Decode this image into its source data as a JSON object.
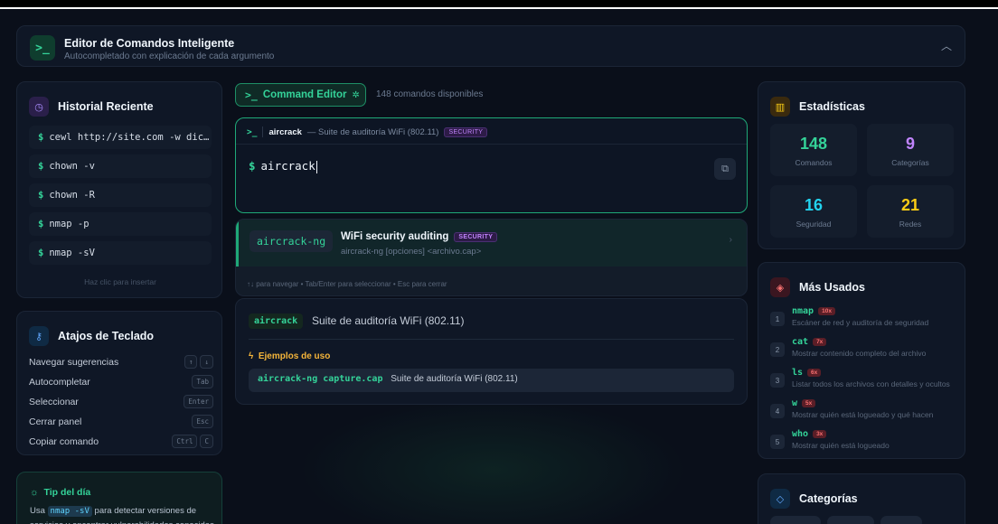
{
  "header": {
    "title": "Editor de Comandos Inteligente",
    "subtitle": "Autocompletado con explicación de cada argumento"
  },
  "history": {
    "title": "Historial Reciente",
    "items": [
      "cewl http://site.com -w dic…",
      "chown -v",
      "chown -R",
      "nmap -p",
      "nmap -sV"
    ],
    "hint": "Haz clic para insertar"
  },
  "shortcuts": {
    "title": "Atajos de Teclado",
    "rows": [
      {
        "label": "Navegar sugerencias",
        "keys": [
          "↑",
          "↓"
        ]
      },
      {
        "label": "Autocompletar",
        "keys": [
          "Tab"
        ]
      },
      {
        "label": "Seleccionar",
        "keys": [
          "Enter"
        ]
      },
      {
        "label": "Cerrar panel",
        "keys": [
          "Esc"
        ]
      },
      {
        "label": "Copiar comando",
        "keys": [
          "Ctrl",
          "C"
        ]
      }
    ]
  },
  "tip": {
    "title": "Tip del día",
    "text_before": "Usa",
    "code": "nmap -sV",
    "text_after": "para detectar versiones de servicios y encontrar vulnerabilidades conocidas"
  },
  "editor": {
    "button_label": "Command Editor",
    "count_text": "148 comandos disponibles",
    "current_cmd": "aircrack",
    "current_desc": "— Suite de auditoría WiFi (802.11)",
    "badge": "SECURITY",
    "input_value": "aircrack"
  },
  "suggestion": {
    "tag": "aircrack-ng",
    "title": "WiFi security auditing",
    "badge": "SECURITY",
    "usage": "aircrack-ng [opciones] <archivo.cap>",
    "hint": "↑↓ para navegar • Tab/Enter para seleccionar • Esc para cerrar"
  },
  "details": {
    "tag": "aircrack",
    "desc": "Suite de auditoría WiFi (802.11)",
    "examples_title": "Ejemplos de uso",
    "example_cmd": "aircrack-ng capture.cap",
    "example_desc": "Suite de auditoría WiFi (802.11)"
  },
  "stats": {
    "title": "Estadísticas",
    "cards": [
      {
        "num": "148",
        "label": "Comandos",
        "color": "#34d399"
      },
      {
        "num": "9",
        "label": "Categorías",
        "color": "#c084fc"
      },
      {
        "num": "16",
        "label": "Seguridad",
        "color": "#22d3ee"
      },
      {
        "num": "21",
        "label": "Redes",
        "color": "#facc15"
      }
    ]
  },
  "most_used": {
    "title": "Más Usados",
    "items": [
      {
        "rank": "1",
        "cmd": "nmap",
        "count": "10x",
        "desc": "Escáner de red y auditoría de seguridad"
      },
      {
        "rank": "2",
        "cmd": "cat",
        "count": "7x",
        "desc": "Mostrar contenido completo del archivo"
      },
      {
        "rank": "3",
        "cmd": "ls",
        "count": "6x",
        "desc": "Listar todos los archivos con detalles y ocultos"
      },
      {
        "rank": "4",
        "cmd": "w",
        "count": "5x",
        "desc": "Mostrar quién está logueado y qué hacen"
      },
      {
        "rank": "5",
        "cmd": "who",
        "count": "3x",
        "desc": "Mostrar quién está logueado"
      }
    ]
  },
  "categories": {
    "title": "Categorías"
  }
}
